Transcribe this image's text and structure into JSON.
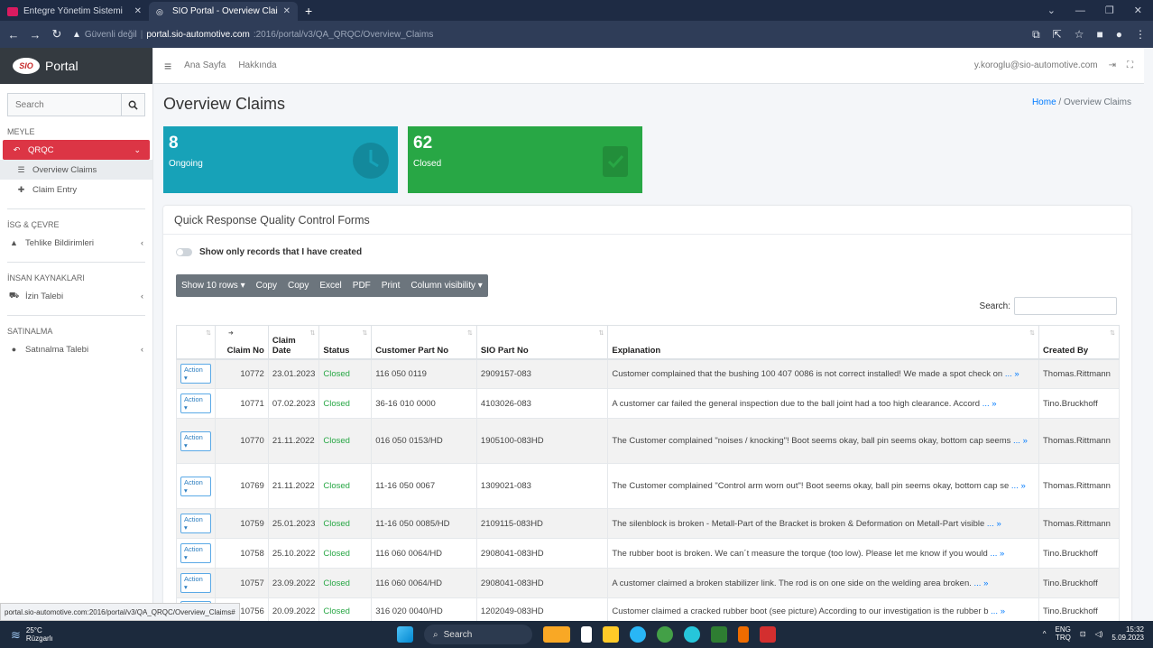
{
  "browser": {
    "tabs": [
      {
        "title": "Entegre Yönetim Sistemi",
        "active": false
      },
      {
        "title": "SIO Portal - Overview Claims",
        "active": true
      }
    ],
    "url_warning": "Güvenli değil",
    "url_host": "portal.sio-automotive.com",
    "url_path": ":2016/portal/v3/QA_QRQC/Overview_Claims",
    "status_url": "portal.sio-automotive.com:2016/portal/v3/QA_QRQC/Overview_Claims#"
  },
  "brand": {
    "logo_text": "SIO",
    "name": "Portal"
  },
  "sidebar": {
    "search_placeholder": "Search",
    "sections": [
      {
        "header": "MEYLE"
      },
      {
        "header": "İSG & ÇEVRE"
      },
      {
        "header": "İNSAN KAYNAKLARI"
      },
      {
        "header": "SATINALMA"
      }
    ],
    "qrqc": "QRQC",
    "overview_claims": "Overview Claims",
    "claim_entry": "Claim Entry",
    "tehlike": "Tehlike Bildirimleri",
    "izin": "İzin Talebi",
    "satinalma": "Satınalma Talebi"
  },
  "topnav": {
    "home": "Ana Sayfa",
    "about": "Hakkında",
    "user": "y.koroglu@sio-automotive.com"
  },
  "page": {
    "title": "Overview Claims",
    "breadcrumb_home": "Home",
    "breadcrumb_sep": " / ",
    "breadcrumb_current": "Overview Claims"
  },
  "stats": {
    "ongoing_count": "8",
    "ongoing_label": "Ongoing",
    "closed_count": "62",
    "closed_label": "Closed",
    "ongoing_color": "#17a2b8",
    "closed_color": "#28a745"
  },
  "card": {
    "title": "Quick Response Quality Control Forms",
    "toggle_label": "Show only records that I have created",
    "buttons": [
      "Show 10 rows ▾",
      "Copy",
      "Copy",
      "Excel",
      "PDF",
      "Print",
      "Column visibility ▾"
    ],
    "search_label": "Search:"
  },
  "table": {
    "headers": [
      "",
      "Claim No",
      "Claim Date",
      "Status",
      "Customer Part No",
      "SIO Part No",
      "Explanation",
      "Created By"
    ],
    "action_label": "Action ▾",
    "more_label": " ... »",
    "rows": [
      {
        "claim_no": "10772",
        "date": "23.01.2023",
        "status": "Closed",
        "customer_part": "116 050 0119",
        "sio_part": "2909157-083",
        "explanation": "Customer complained that the bushing 100 407 0086 is not correct installed! We made a spot check on",
        "created_by": "Thomas.Rittmann"
      },
      {
        "claim_no": "10771",
        "date": "07.02.2023",
        "status": "Closed",
        "customer_part": "36-16 010 0000",
        "sio_part": "4103026-083",
        "explanation": "A customer car failed the general inspection due to the ball joint had a too high clearance. Accord",
        "created_by": "Tino.Bruckhoff"
      },
      {
        "claim_no": "10770",
        "date": "21.11.2022",
        "status": "Closed",
        "customer_part": "016 050 0153/HD",
        "sio_part": "1905100-083HD",
        "explanation": "The Customer complained \"noises / knocking\"! Boot seems okay, ball pin seems okay, bottom cap seems",
        "created_by": "Thomas.Rittmann"
      },
      {
        "claim_no": "10769",
        "date": "21.11.2022",
        "status": "Closed",
        "customer_part": "11-16 050 0067",
        "sio_part": "1309021-083",
        "explanation": "The Customer complained \"Control arm worn out\"! Boot seems okay, ball pin seems okay, bottom cap se",
        "created_by": "Thomas.Rittmann"
      },
      {
        "claim_no": "10759",
        "date": "25.01.2023",
        "status": "Closed",
        "customer_part": "11-16 050 0085/HD",
        "sio_part": "2109115-083HD",
        "explanation": "The silenblock is broken - Metall-Part of the Bracket is broken & Deformation on Metall-Part visible",
        "created_by": "Thomas.Rittmann"
      },
      {
        "claim_no": "10758",
        "date": "25.10.2022",
        "status": "Closed",
        "customer_part": "116 060 0064/HD",
        "sio_part": "2908041-083HD",
        "explanation": "The rubber boot is broken. We can´t measure the torque (too low). Please let me know if you would",
        "created_by": "Tino.Bruckhoff"
      },
      {
        "claim_no": "10757",
        "date": "23.09.2022",
        "status": "Closed",
        "customer_part": "116 060 0064/HD",
        "sio_part": "2908041-083HD",
        "explanation": "A customer claimed a broken stabilizer link. The rod is on one side on the welding area broken.",
        "created_by": "Tino.Bruckhoff"
      },
      {
        "claim_no": "10756",
        "date": "20.09.2022",
        "status": "Closed",
        "customer_part": "316 020 0040/HD",
        "sio_part": "1202049-083HD",
        "explanation": "Customer claimed a cracked rubber boot (see picture) According to our investigation is the rubber b",
        "created_by": "Tino.Bruckhoff"
      }
    ]
  },
  "taskbar": {
    "temp": "25°C",
    "weather": "Rüzgarlı",
    "search": "Search",
    "lang1": "ENG",
    "lang2": "TRQ",
    "time": "15:32",
    "date": "5.09.2023"
  }
}
